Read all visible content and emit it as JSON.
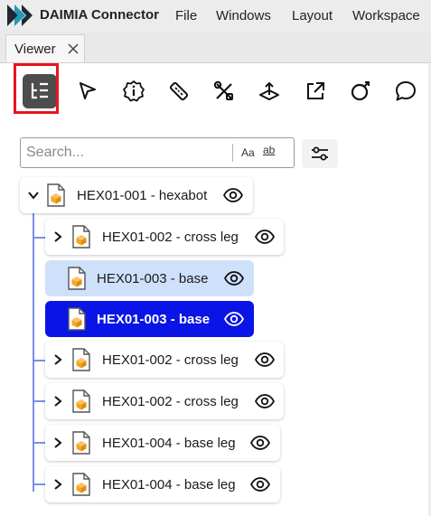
{
  "app": {
    "title": "DAIMIA Connector",
    "brand_colors": {
      "logo_dark": "#1d2a33",
      "logo_teal": "#1f9bb8"
    }
  },
  "menu": {
    "items": [
      "File",
      "Windows",
      "Layout",
      "Workspace"
    ]
  },
  "tab": {
    "label": "Viewer",
    "close_icon": "close-icon"
  },
  "toolbar": {
    "tools": [
      {
        "icon": "tree-list-icon",
        "active": true
      },
      {
        "icon": "cursor-select-icon",
        "active": false
      },
      {
        "icon": "info-badge-icon",
        "active": false
      },
      {
        "icon": "ruler-icon",
        "active": false
      },
      {
        "icon": "tools-icon",
        "active": false
      },
      {
        "icon": "section-plane-icon",
        "active": false
      },
      {
        "icon": "external-link-icon",
        "active": false
      },
      {
        "icon": "explode-icon",
        "active": false
      },
      {
        "icon": "comment-icon",
        "active": false
      }
    ],
    "highlight_color": "#e8141e"
  },
  "search": {
    "placeholder": "Search...",
    "value": "",
    "match_case_label": "Aa",
    "whole_word_label": "ab",
    "filter_icon": "sliders-icon"
  },
  "tree": {
    "root": {
      "label": "HEX01-001  -  hexabot",
      "expanded": true
    },
    "children": [
      {
        "label": "HEX01-002  -  cross leg",
        "expandable": true,
        "state": "normal"
      },
      {
        "label": "HEX01-003  -  base",
        "expandable": false,
        "state": "ghost"
      },
      {
        "label": "HEX01-003  -  base",
        "expandable": false,
        "state": "selected"
      },
      {
        "label": "HEX01-002  -  cross leg",
        "expandable": true,
        "state": "normal"
      },
      {
        "label": "HEX01-002  -  cross leg",
        "expandable": true,
        "state": "normal"
      },
      {
        "label": "HEX01-004  -  base leg",
        "expandable": true,
        "state": "normal"
      },
      {
        "label": "HEX01-004  -  base leg",
        "expandable": true,
        "state": "normal"
      }
    ],
    "colors": {
      "selected": "#0a14e6",
      "ghost": "#cfe0fb",
      "connector": "#7a8fe8",
      "part_orange": "#f5a623"
    }
  }
}
